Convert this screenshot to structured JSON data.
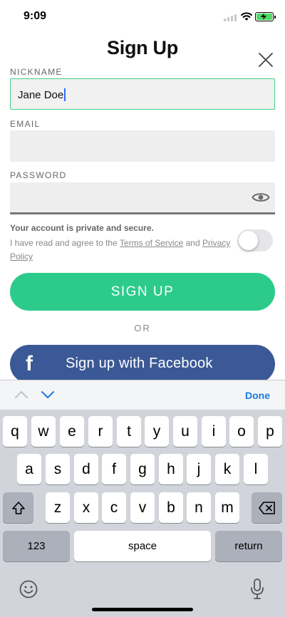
{
  "status_bar": {
    "time": "9:09"
  },
  "header": {
    "title": "Sign Up"
  },
  "form": {
    "nickname_label": "NICKNAME",
    "nickname_value": "Jane Doe",
    "email_label": "EMAIL",
    "email_value": "",
    "password_label": "PASSWORD",
    "password_value": ""
  },
  "consent": {
    "private_text": "Your account is private and secure.",
    "prefix": "I have read and agree to the ",
    "terms_link": "Terms of Service",
    "middle": " and ",
    "privacy_link": "Privacy Policy",
    "agreed": false
  },
  "actions": {
    "signup_label": "SIGN UP",
    "or_label": "OR",
    "facebook_icon": "f",
    "facebook_label": "Sign up with Facebook"
  },
  "keyboard": {
    "done_label": "Done",
    "row1": [
      "q",
      "w",
      "e",
      "r",
      "t",
      "y",
      "u",
      "i",
      "o",
      "p"
    ],
    "row2": [
      "a",
      "s",
      "d",
      "f",
      "g",
      "h",
      "j",
      "k",
      "l"
    ],
    "row3": [
      "z",
      "x",
      "c",
      "v",
      "b",
      "n",
      "m"
    ],
    "numbers_label": "123",
    "space_label": "space",
    "return_label": "return"
  },
  "colors": {
    "accent_green": "#2ccb8b",
    "facebook_blue": "#3b5996",
    "ios_blue": "#1a7ae0"
  },
  "icons": [
    "close-icon",
    "eye-icon",
    "chevron-up-icon",
    "chevron-down-icon",
    "shift-icon",
    "backspace-icon",
    "emoji-icon",
    "microphone-icon",
    "wifi-icon",
    "battery-icon",
    "signal-icon"
  ]
}
